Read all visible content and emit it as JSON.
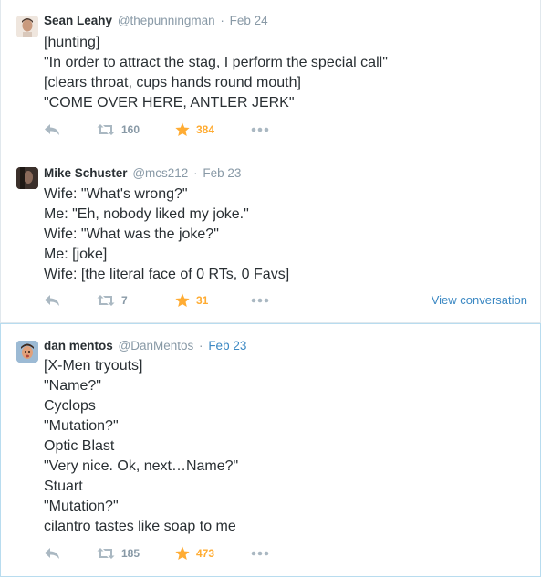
{
  "colors": {
    "text": "#292f33",
    "muted": "#8899a6",
    "icon": "#aab8c2",
    "favorite": "#ffac33",
    "link": "#3b88c3",
    "border": "#e1e8ed",
    "highlight_border": "#b8dcef"
  },
  "tweets": [
    {
      "fullname": "Sean Leahy",
      "username": "@thepunningman",
      "separator": "·",
      "time": "Feb 24",
      "lines": [
        "[hunting]",
        "\"In order to attract the stag, I perform the special call\"",
        "[clears throat, cups hands round mouth]",
        "\"COME OVER HERE, ANTLER JERK\""
      ],
      "retweets": "160",
      "favorites": "384",
      "icons": {
        "avatar": "avatar",
        "reply": "reply-icon",
        "retweet": "retweet-icon",
        "favorite": "star-icon",
        "more": "more-icon"
      }
    },
    {
      "fullname": "Mike Schuster",
      "username": "@mcs212",
      "separator": "·",
      "time": "Feb 23",
      "lines": [
        "Wife: \"What's wrong?\"",
        "Me: \"Eh, nobody liked my joke.\"",
        "Wife: \"What was the joke?\"",
        "Me: [joke]",
        "Wife: [the literal face of 0 RTs, 0 Favs]"
      ],
      "retweets": "7",
      "favorites": "31",
      "view_conversation": "View conversation",
      "icons": {
        "avatar": "avatar",
        "reply": "reply-icon",
        "retweet": "retweet-icon",
        "favorite": "star-icon",
        "more": "more-icon"
      }
    },
    {
      "fullname": "dan mentos",
      "username": "@DanMentos",
      "separator": "·",
      "time": "Feb 23",
      "lines": [
        "[X-Men tryouts]",
        "\"Name?\"",
        "Cyclops",
        "\"Mutation?\"",
        "Optic Blast",
        "\"Very nice. Ok, next…Name?\"",
        "Stuart",
        "\"Mutation?\"",
        "cilantro tastes like soap to me"
      ],
      "retweets": "185",
      "favorites": "473",
      "icons": {
        "avatar": "avatar",
        "reply": "reply-icon",
        "retweet": "retweet-icon",
        "favorite": "star-icon",
        "more": "more-icon"
      }
    }
  ]
}
